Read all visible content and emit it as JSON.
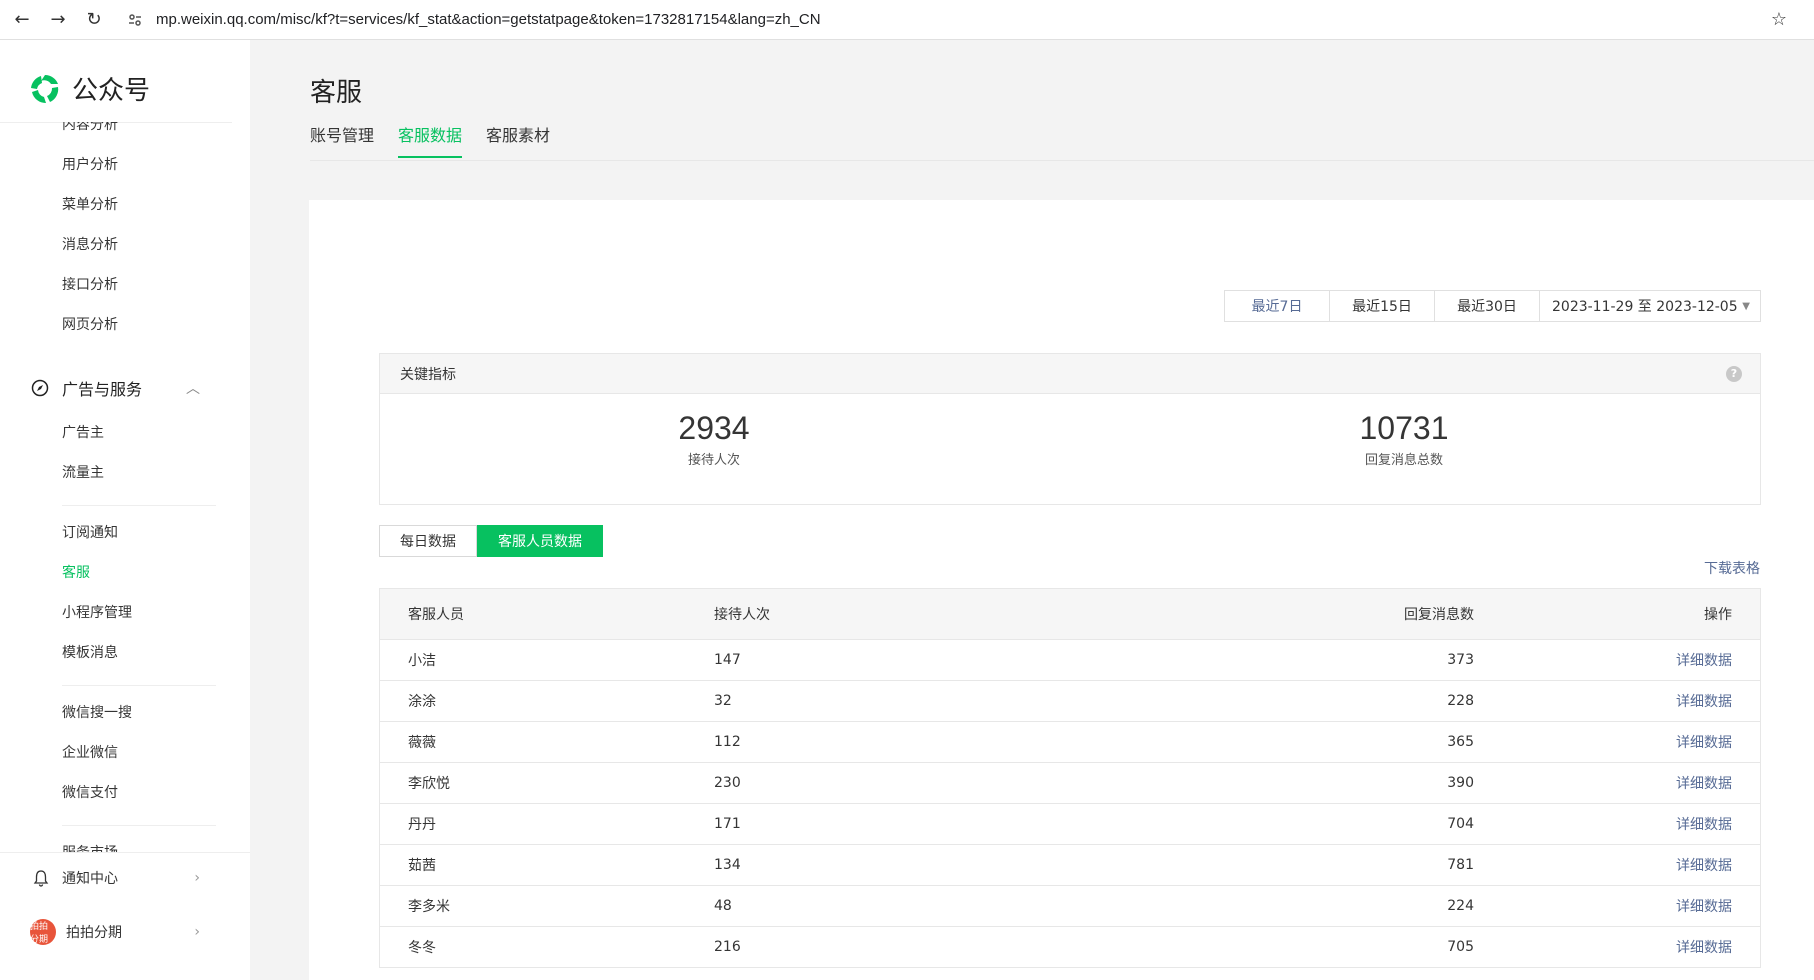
{
  "browser": {
    "url": "mp.weixin.qq.com/misc/kf?t=services/kf_stat&action=getstatpage&token=1732817154&lang=zh_CN"
  },
  "sidebar": {
    "brand": "公众号",
    "analysis_items": [
      "内容分析",
      "用户分析",
      "菜单分析",
      "消息分析",
      "接口分析",
      "网页分析"
    ],
    "ads_group": "广告与服务",
    "ads_items": [
      "广告主",
      "流量主"
    ],
    "service_items": [
      "订阅通知",
      "客服",
      "小程序管理",
      "模板消息"
    ],
    "other_items": [
      "微信搜一搜",
      "企业微信",
      "微信支付"
    ],
    "partial_item": "服务市场",
    "notify": "通知中心",
    "account": "拍拍分期",
    "avatar_text": "拍拍\n分期"
  },
  "header": {
    "title": "客服",
    "tabs": [
      "账号管理",
      "客服数据",
      "客服素材"
    ]
  },
  "range": {
    "buttons": [
      "最近7日",
      "最近15日",
      "最近30日"
    ],
    "date": "2023-11-29 至 2023-12-05"
  },
  "metrics": {
    "title": "关键指标",
    "help": "?",
    "items": [
      {
        "value": "2934",
        "label": "接待人次"
      },
      {
        "value": "10731",
        "label": "回复消息总数"
      }
    ]
  },
  "segments": [
    "每日数据",
    "客服人员数据"
  ],
  "download": "下载表格",
  "table": {
    "headers": [
      "客服人员",
      "接待人次",
      "回复消息数",
      "操作"
    ],
    "rows": [
      [
        "小洁",
        "147",
        "373",
        "详细数据"
      ],
      [
        "涂涂",
        "32",
        "228",
        "详细数据"
      ],
      [
        "薇薇",
        "112",
        "365",
        "详细数据"
      ],
      [
        "李欣悦",
        "230",
        "390",
        "详细数据"
      ],
      [
        "丹丹",
        "171",
        "704",
        "详细数据"
      ],
      [
        "茹茜",
        "134",
        "781",
        "详细数据"
      ],
      [
        "李多米",
        "48",
        "224",
        "详细数据"
      ],
      [
        "冬冬",
        "216",
        "705",
        "详细数据"
      ]
    ]
  },
  "colors": {
    "accent": "#07c160",
    "link": "#576b95"
  }
}
